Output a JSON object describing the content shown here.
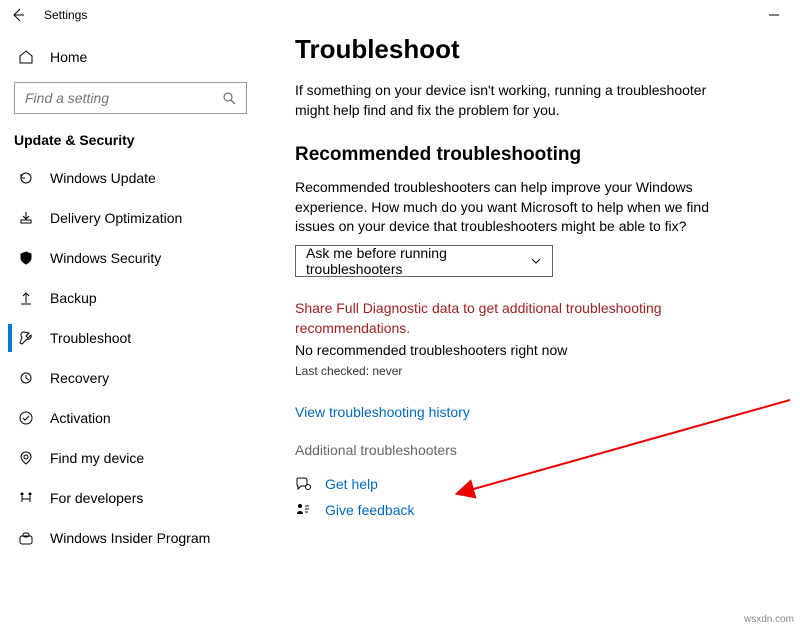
{
  "titlebar": {
    "title": "Settings"
  },
  "sidebar": {
    "home_label": "Home",
    "search_placeholder": "Find a setting",
    "section_label": "Update & Security",
    "items": [
      {
        "label": "Windows Update"
      },
      {
        "label": "Delivery Optimization"
      },
      {
        "label": "Windows Security"
      },
      {
        "label": "Backup"
      },
      {
        "label": "Troubleshoot"
      },
      {
        "label": "Recovery"
      },
      {
        "label": "Activation"
      },
      {
        "label": "Find my device"
      },
      {
        "label": "For developers"
      },
      {
        "label": "Windows Insider Program"
      }
    ]
  },
  "main": {
    "title": "Troubleshoot",
    "intro": "If something on your device isn't working, running a troubleshooter might help find and fix the problem for you.",
    "rec_heading": "Recommended troubleshooting",
    "rec_desc": "Recommended troubleshooters can help improve your Windows experience. How much do you want Microsoft to help when we find issues on your device that troubleshooters might be able to fix?",
    "dropdown_value": "Ask me before running troubleshooters",
    "warning": "Share Full Diagnostic data to get additional troubleshooting recommendations.",
    "no_rec": "No recommended troubleshooters right now",
    "last_checked": "Last checked: never",
    "history_link": "View troubleshooting history",
    "additional_heading": "Additional troubleshooters",
    "get_help": "Get help",
    "give_feedback": "Give feedback"
  },
  "watermark": "wsxdn.com"
}
